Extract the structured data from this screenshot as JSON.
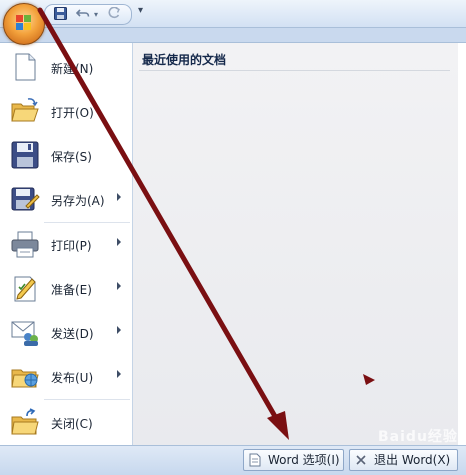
{
  "quick_access": {
    "save_icon": "floppy-disk-icon",
    "undo_icon": "undo-icon",
    "redo_icon": "redo-icon",
    "customize_icon": "dropdown-icon"
  },
  "menu": {
    "items": [
      {
        "label": "新建(N)",
        "icon": "new-document-icon",
        "has_submenu": false
      },
      {
        "label": "打开(O)",
        "icon": "open-folder-icon",
        "has_submenu": false
      },
      {
        "label": "保存(S)",
        "icon": "save-icon",
        "has_submenu": false
      },
      {
        "label": "另存为(A)",
        "icon": "save-as-icon",
        "has_submenu": true
      },
      {
        "label": "打印(P)",
        "icon": "printer-icon",
        "has_submenu": true
      },
      {
        "label": "准备(E)",
        "icon": "prepare-icon",
        "has_submenu": true
      },
      {
        "label": "发送(D)",
        "icon": "send-icon",
        "has_submenu": true
      },
      {
        "label": "发布(U)",
        "icon": "publish-icon",
        "has_submenu": true
      },
      {
        "label": "关闭(C)",
        "icon": "close-folder-icon",
        "has_submenu": false
      }
    ]
  },
  "recent_documents": {
    "title": "最近使用的文档",
    "items": []
  },
  "footer": {
    "options_button": "Word 选项(I)",
    "exit_button": "退出 Word(X)"
  },
  "annotation": {
    "arrow_color": "#7a0f12"
  },
  "watermark": {
    "text": "Baidu经验"
  }
}
